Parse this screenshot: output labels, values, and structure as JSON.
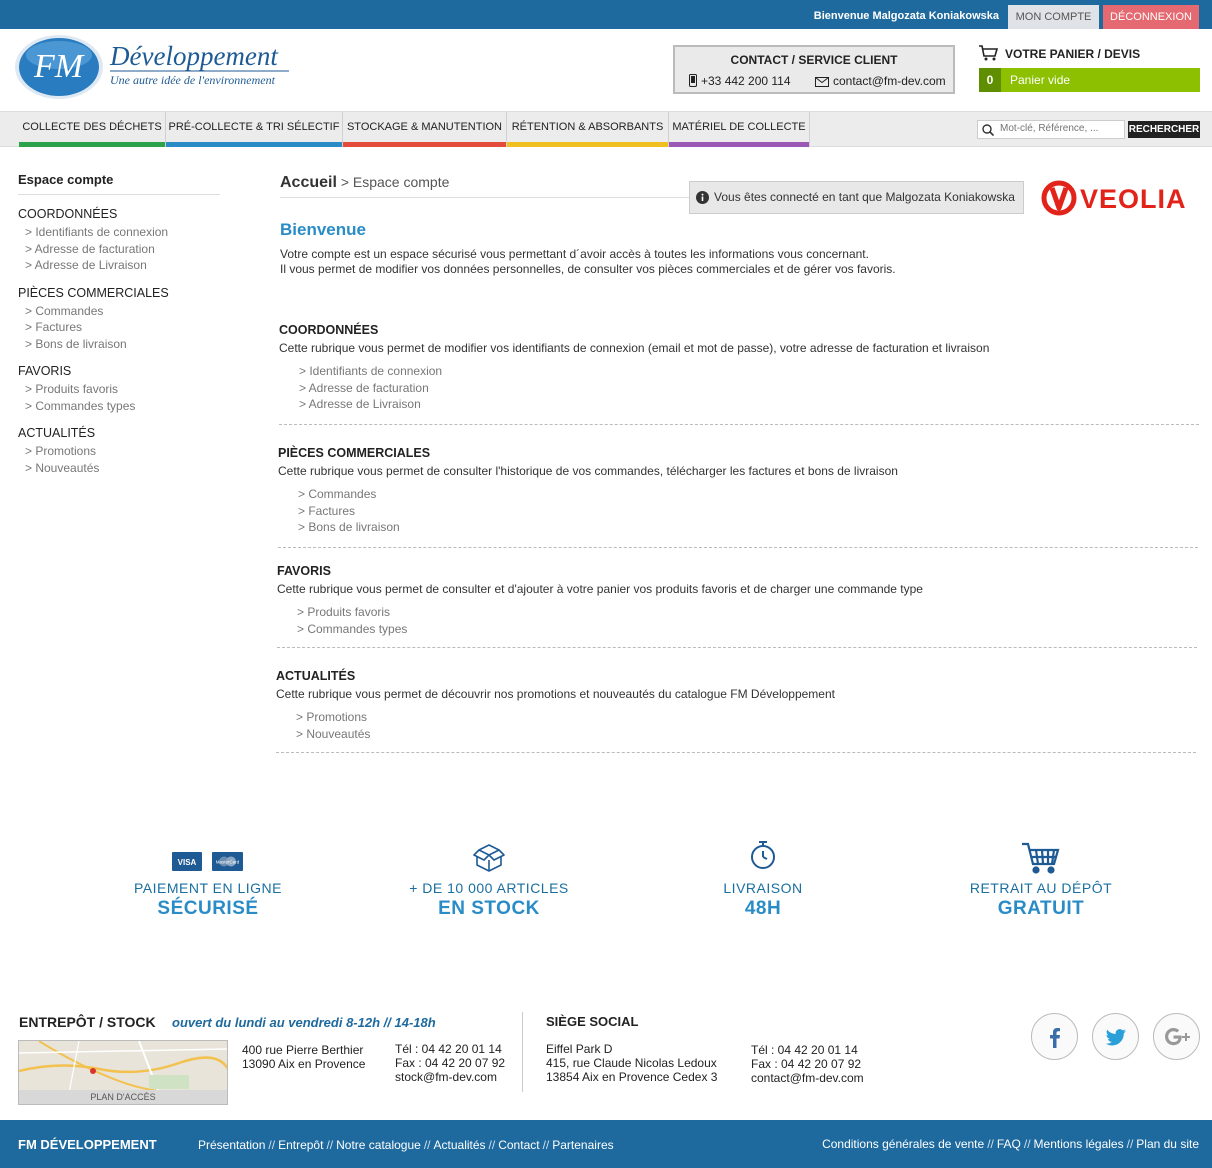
{
  "topbar": {
    "welcome": "Bienvenue Malgozata Koniakowska",
    "account_btn": "MON COMPTE",
    "logout_btn": "DÉCONNEXION"
  },
  "logo": {
    "brand": "FM",
    "name": "Développement",
    "tagline": "Une autre idée de l'environnement"
  },
  "contact": {
    "title": "CONTACT / SERVICE CLIENT",
    "phone": "+33 442 200 114",
    "email": "contact@fm-dev.com"
  },
  "cart": {
    "title": "VOTRE PANIER / DEVIS",
    "count": "0",
    "status": "Panier vide"
  },
  "nav": {
    "items": [
      {
        "label": "COLLECTE DES DÉCHETS",
        "color": "#2ca24a"
      },
      {
        "label": "PRÉ-COLLECTE & TRI SÉLECTIF",
        "color": "#2a8cc7"
      },
      {
        "label": "STOCKAGE & MANUTENTION",
        "color": "#e34b3b"
      },
      {
        "label": "RÉTENTION & ABSORBANTS",
        "color": "#f0c020"
      },
      {
        "label": "MATÉRIEL DE COLLECTE",
        "color": "#9b59b6"
      }
    ],
    "search_placeholder": "Mot-clé, Référence, ...",
    "search_btn": "RECHERCHER"
  },
  "sidebar": {
    "title": "Espace compte",
    "sections": [
      {
        "title": "COORDONNÉES",
        "links": [
          "> Identifiants de connexion",
          "> Adresse de facturation",
          "> Adresse de Livraison"
        ]
      },
      {
        "title": "PIÈCES COMMERCIALES",
        "links": [
          "> Commandes",
          "> Factures",
          "> Bons de livraison"
        ]
      },
      {
        "title": "FAVORIS",
        "links": [
          "> Produits favoris",
          "> Commandes types"
        ]
      },
      {
        "title": "ACTUALITÉS",
        "links": [
          "> Promotions",
          "> Nouveautés"
        ]
      }
    ]
  },
  "main": {
    "breadcrumb_home": "Accueil",
    "breadcrumb_current": "> Espace compte",
    "connected_msg": "Vous êtes connecté en tant que Malgozata Koniakowska",
    "partner_logo": "VEOLIA",
    "welcome_title": "Bienvenue",
    "welcome_line1": "Votre compte est un espace sécurisé vous permettant d´avoir accès à toutes les informations vous concernant.",
    "welcome_line2": "Il vous permet de modifier vos données personnelles, de consulter vos pièces commerciales et de gérer vos favoris.",
    "sections": [
      {
        "title": "COORDONNÉES",
        "desc": "Cette rubrique vous permet de modifier vos identifiants de connexion (email et mot de passe), votre adresse de facturation et livraison",
        "links": [
          "> Identifiants de connexion",
          "> Adresse de facturation",
          "> Adresse de Livraison"
        ]
      },
      {
        "title": "PIÈCES COMMERCIALES",
        "desc": "Cette rubrique vous permet de consulter l'historique de vos commandes, télécharger les factures et bons de livraison",
        "links": [
          "> Commandes",
          "> Factures",
          "> Bons de livraison"
        ]
      },
      {
        "title": "FAVORIS",
        "desc": "Cette rubrique vous permet de consulter et d'ajouter à votre panier vos produits favoris et de charger une commande type",
        "links": [
          "> Produits favoris",
          "> Commandes types"
        ]
      },
      {
        "title": "ACTUALITÉS",
        "desc": "Cette rubrique vous permet de découvrir nos promotions et nouveautés du catalogue FM Développement",
        "links": [
          "> Promotions",
          "> Nouveautés"
        ]
      }
    ]
  },
  "features": [
    {
      "line1": "PAIEMENT EN LIGNE",
      "line2": "SÉCURISÉ",
      "icon": "credit-cards-icon",
      "card1": "VISA",
      "card2": "MasterCard"
    },
    {
      "line1": "+ DE 10 000 ARTICLES",
      "line2": "EN STOCK",
      "icon": "boxes-icon"
    },
    {
      "line1": "LIVRAISON",
      "line2": "48H",
      "icon": "stopwatch-icon"
    },
    {
      "line1": "RETRAIT AU DÉPÔT",
      "line2": "GRATUIT",
      "icon": "cart-icon"
    }
  ],
  "footer": {
    "stock_title": "ENTREPÔT / STOCK",
    "stock_hours": "ouvert du lundi au vendredi 8-12h // 14-18h",
    "map_label": "PLAN D'ACCÈS",
    "stock_addr1": "400 rue Pierre Berthier",
    "stock_addr2": "13090 Aix en Provence",
    "stock_tel": "Tél : 04 42 20 01 14",
    "stock_fax": "Fax : 04 42 20 07 92",
    "stock_email": "stock@fm-dev.com",
    "hq_title": "SIÈGE SOCIAL",
    "hq_addr1": "Eiffel Park D",
    "hq_addr2": "415, rue Claude Nicolas Ledoux",
    "hq_addr3": "13854 Aix en Provence Cedex 3",
    "hq_tel": "Tél : 04 42 20 01 14",
    "hq_fax": "Fax : 04 42 20 07 92",
    "hq_email": "contact@fm-dev.com"
  },
  "bottombar": {
    "brand": "FM DÉVELOPPEMENT",
    "links": [
      "Présentation",
      "Entrepôt",
      "Notre catalogue",
      "Actualités",
      "Contact",
      "Partenaires"
    ],
    "legal": [
      "Conditions générales de vente",
      "FAQ",
      "Mentions légales",
      "Plan du site"
    ]
  },
  "colors": {
    "primary": "#1e6a9e",
    "accent": "#2a8cc7",
    "cart_green": "#8cc000",
    "logout_red": "#e46971",
    "veolia_red": "#e2231a"
  }
}
